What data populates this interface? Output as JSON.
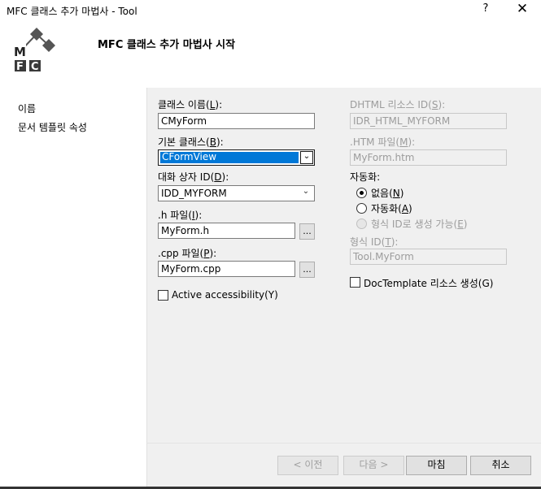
{
  "window": {
    "title": "MFC 클래스 추가 마법사 - Tool",
    "help": "?",
    "close": "✕"
  },
  "header": {
    "title": "MFC 클래스 추가 마법사 시작",
    "logo_letters": [
      "M",
      "F",
      "C"
    ]
  },
  "sidebar": {
    "items": [
      {
        "label": "이름"
      },
      {
        "label": "문서 템플릿 속성"
      }
    ]
  },
  "form": {
    "class_name": {
      "label_pre": "클래스 이름(",
      "key": "L",
      "label_post": "):",
      "value": "CMyForm"
    },
    "base_class": {
      "label_pre": "기본 클래스(",
      "key": "B",
      "label_post": "):",
      "value": "CFormView"
    },
    "dialog_id": {
      "label_pre": "대화 상자 ID(",
      "key": "D",
      "label_post": "):",
      "value": "IDD_MYFORM"
    },
    "h_file": {
      "label_pre": ".h 파일(",
      "key": "I",
      "label_post": "):",
      "value": "MyForm.h",
      "browse": "..."
    },
    "cpp_file": {
      "label_pre": ".cpp 파일(",
      "key": "P",
      "label_post": "):",
      "value": "MyForm.cpp",
      "browse": "..."
    },
    "active_accessibility": {
      "label": "Active accessibility(Y)"
    },
    "dhtml_id": {
      "label_pre": "DHTML 리소스 ID(",
      "key": "S",
      "label_post": "):",
      "value": "IDR_HTML_MYFORM"
    },
    "htm_file": {
      "label_pre": ".HTM 파일(",
      "key": "M",
      "label_post": "):",
      "value": "MyForm.htm"
    },
    "automation": {
      "label": "자동화:",
      "options": [
        {
          "label_pre": "없음(",
          "key": "N",
          "label_post": ")"
        },
        {
          "label_pre": "자동화(",
          "key": "A",
          "label_post": ")"
        },
        {
          "label_pre": "형식 ID로 생성 가능(",
          "key": "E",
          "label_post": ")"
        }
      ]
    },
    "type_id": {
      "label_pre": "형식 ID(",
      "key": "T",
      "label_post": "):",
      "value": "Tool.MyForm"
    },
    "doctemplate": {
      "label": "DocTemplate 리소스 생성(G)"
    }
  },
  "buttons": {
    "prev": "< 이전",
    "next": "다음 >",
    "finish": "마침",
    "cancel": "취소"
  }
}
